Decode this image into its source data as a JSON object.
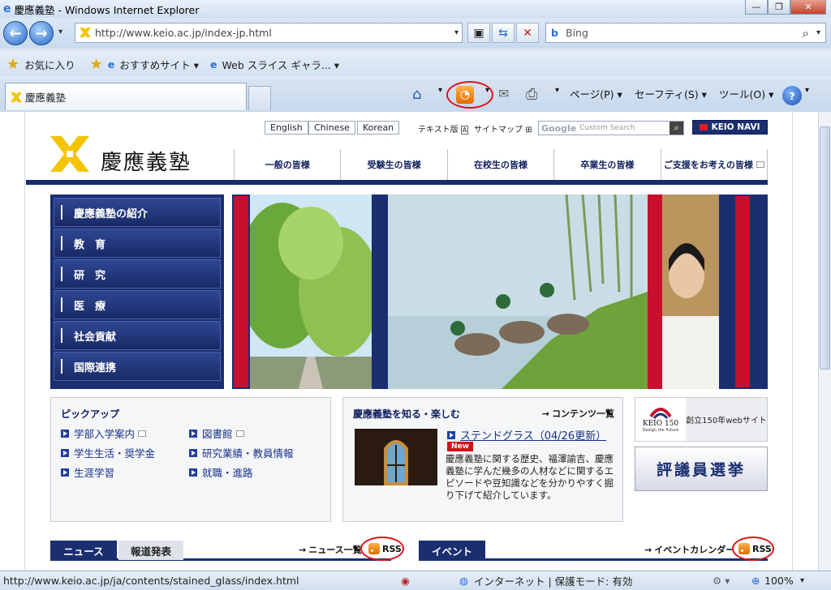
{
  "window": {
    "title": "慶應義塾 - Windows Internet Explorer",
    "min": "—",
    "max": "❐",
    "close": "✕"
  },
  "nav": {
    "url": "http://www.keio.ac.jp/index-jp.html",
    "search_placeholder": "Bing"
  },
  "favorites": {
    "fav_label": "お気に入り",
    "items": [
      "おすすめサイト ▾",
      "Web スライス ギャラ... ▾"
    ]
  },
  "tab": {
    "title": "慶應義塾"
  },
  "commands": {
    "page": "ページ(P) ▾",
    "safety": "セーフティ(S) ▾",
    "tools": "ツール(O) ▾"
  },
  "site": {
    "lang": [
      "English",
      "Chinese",
      "Korean"
    ],
    "text_version": "テキスト版",
    "sitemap": "サイトマップ",
    "search_placeholder": "Custom Search",
    "keio_navi": "KEIO NAVI",
    "logo_text": "慶應義塾",
    "topnav": [
      "一般の皆様",
      "受験生の皆様",
      "在校生の皆様",
      "卒業生の皆様",
      "ご支援をお考えの皆様"
    ],
    "leftmenu": [
      "慶應義塾の紹介",
      "教　育",
      "研　究",
      "医　療",
      "社会貢献",
      "国際連携"
    ],
    "pickup": {
      "title": "ピックアップ",
      "links": [
        "学部入学案内",
        "図書館",
        "学生生活・奨学金",
        "研究業績・教員情報",
        "生涯学習",
        "就職・進路"
      ]
    },
    "enjoy": {
      "title": "慶應義塾を知る・楽しむ",
      "contents_link": "コンテンツ一覧",
      "article_title": "ステンドグラス（04/26更新）",
      "new_badge": "New",
      "article_body": "慶應義塾に関する歴史、福澤諭吉、慶應義塾に学んだ幾多の人材などに関するエピソードや豆知識などを分かりやすく掘り下げて紹介しています。"
    },
    "keio150": {
      "logo": "KEIO 150",
      "tagline": "Design the Future",
      "label": "創立150年webサイト"
    },
    "councillor": "評議員選挙",
    "news": {
      "tab_news": "ニュース",
      "tab_press": "報道発表",
      "list_link": "ニュース一覧",
      "rss": "RSS"
    },
    "events": {
      "tab": "イベント",
      "calendar_link": "イベントカレンダー",
      "rss": "RSS"
    }
  },
  "status": {
    "url": "http://www.keio.ac.jp/ja/contents/stained_glass/index.html",
    "zone": "インターネット | 保護モード: 有効",
    "zoom": "100%"
  }
}
